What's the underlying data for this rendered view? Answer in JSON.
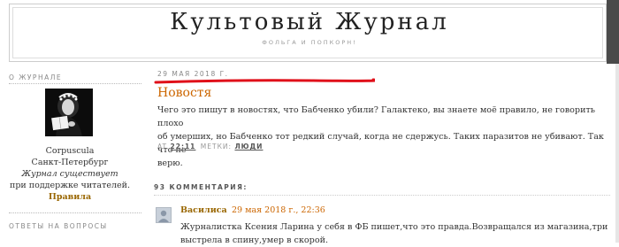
{
  "header": {
    "title": "Культовый Журнал",
    "description": "ФОЛЬГА И ПОПКОРН!"
  },
  "sidebar": {
    "about_heading": "О ЖУРНАЛЕ",
    "profile_name": "Corpuscula",
    "profile_city": "Санкт-Петербург",
    "profile_line1": "Журнал существует",
    "profile_line2": "при поддержке читателей.",
    "rules_link": "Правила",
    "answers_heading": "ОТВЕТЫ НА ВОПРОСЫ"
  },
  "post": {
    "date": "29 МАЯ 2018 Г.",
    "title": "Новостя",
    "body_line1": "Чего это пишут в новостях, что Бабченко убили? Галактеко, вы знаете моё правило, не говорить плохо",
    "body_line2": "об умерших, но Бабченко тот редкий случай, когда не сдержусь. Таких паразитов не убивают. Так что не",
    "body_line3": "верю.",
    "footer_at": "AT",
    "footer_time": "22:11",
    "footer_labels": "МЕТКИ:",
    "footer_tag": "ЛЮДИ"
  },
  "comments": {
    "heading": "93 КОММЕНТАРИЯ:",
    "items": [
      {
        "author": "Василиса",
        "date": "29 мая 2018 г., 22:36",
        "text_line1": "Журналистка Ксения Ларина у себя в ФБ пишет,что это правда.Возвращался из магазина,три",
        "text_line2": "выстрела в спину,умер в скорой."
      }
    ]
  },
  "colors": {
    "accent_orange": "#cc6600",
    "link_brown": "#996600",
    "annotation_red": "#e0101a"
  }
}
